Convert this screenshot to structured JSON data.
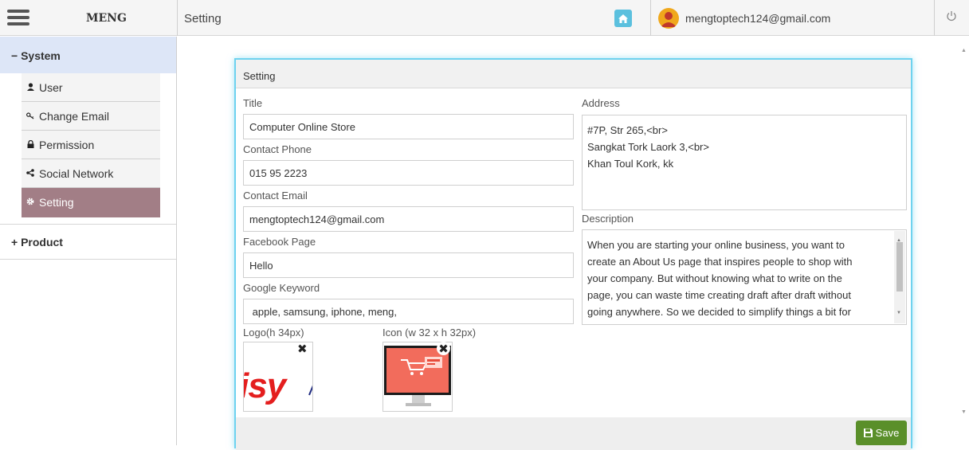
{
  "header": {
    "brand": "MENG",
    "page_title": "Setting",
    "user_email": "mengtoptech124@gmail.com"
  },
  "sidebar": {
    "system_label": "− System",
    "items": [
      {
        "label": "User",
        "icon": "user-icon"
      },
      {
        "label": "Change Email",
        "icon": "key-icon"
      },
      {
        "label": "Permission",
        "icon": "lock-icon"
      },
      {
        "label": "Social Network",
        "icon": "share-icon"
      },
      {
        "label": "Setting",
        "icon": "gear-icon",
        "active": true
      }
    ],
    "product_label": "+ Product"
  },
  "modal": {
    "title": "Setting",
    "fields": {
      "title_label": "Title",
      "title_value": "Computer Online Store",
      "phone_label": "Contact Phone",
      "phone_value": "015 95 2223",
      "email_label": "Contact Email",
      "email_value": "mengtoptech124@gmail.com",
      "facebook_label": "Facebook Page",
      "facebook_value": "Hello",
      "keyword_label": "Google Keyword",
      "keyword_value": " apple, samsung, iphone, meng,",
      "address_label": "Address",
      "address_lines": [
        "#7P, Str 265,<br>",
        "Sangkat Tork Laork 3,<br>",
        "Khan Toul Kork, kk"
      ],
      "description_label": "Description",
      "description_lines": [
        "When you are starting your online business, you want to",
        "create an About Us page that inspires people to shop with",
        "your company. But without knowing what to write on the",
        "page, you can waste time creating draft after draft without",
        "going anywhere. So we decided to simplify things a bit for"
      ],
      "logo_label": "Logo(h 34px)",
      "logo_text": "isy",
      "icon_label": "Icon (w 32 x h 32px)"
    },
    "save_label": "Save"
  },
  "colors": {
    "system_bg": "#dde6f7",
    "active_item_bg": "#a27e86",
    "modal_border": "#6dd2ef",
    "save_button": "#5a8f2a",
    "home_button": "#5bc0de"
  }
}
